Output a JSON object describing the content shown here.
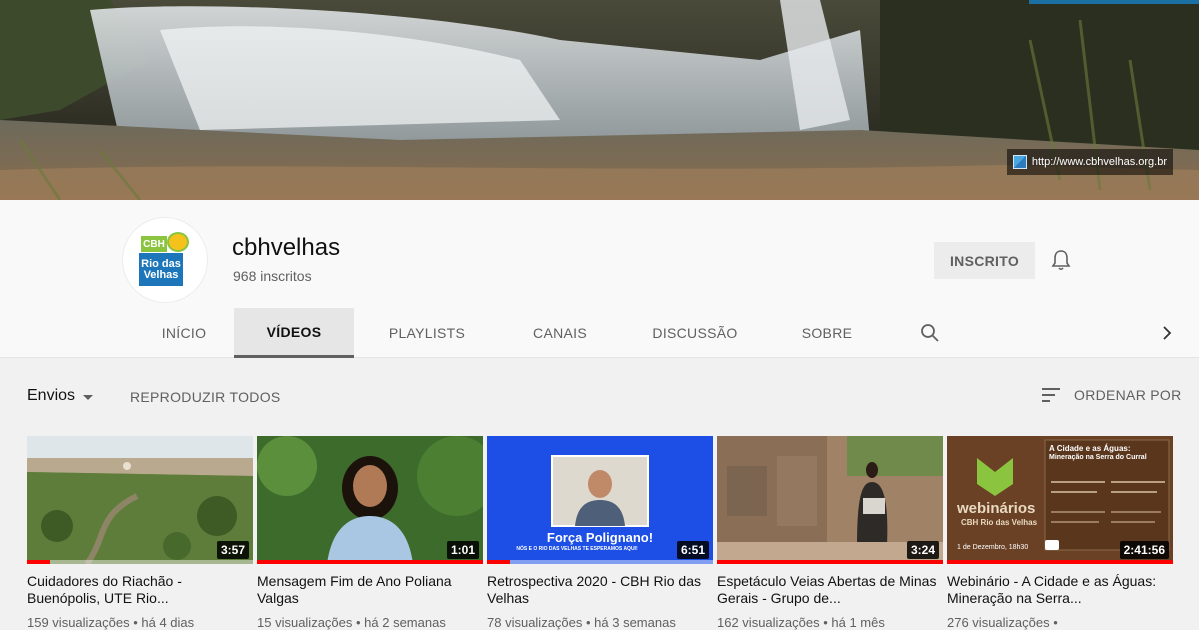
{
  "banner": {
    "link_text": "http://www.cbhvelhas.org.br"
  },
  "channel": {
    "name": "cbhvelhas",
    "subscribers": "968 inscritos",
    "subscribed_label": "INSCRITO",
    "avatar_top": "CBH",
    "avatar_bottom": "Rio das Velhas"
  },
  "tabs": [
    {
      "label": "INÍCIO",
      "active": false
    },
    {
      "label": "VÍDEOS",
      "active": true
    },
    {
      "label": "PLAYLISTS",
      "active": false
    },
    {
      "label": "CANAIS",
      "active": false
    },
    {
      "label": "DISCUSSÃO",
      "active": false
    },
    {
      "label": "SOBRE",
      "active": false
    }
  ],
  "toolbar": {
    "uploads_label": "Envios",
    "play_all_label": "REPRODUZIR TODOS",
    "sort_label": "ORDENAR POR"
  },
  "videos": [
    {
      "title": "Cuidadores do Riachão - Buenópolis, UTE Rio...",
      "meta": "159 visualizações • há 4 dias",
      "duration": "3:57",
      "watched": 0.1
    },
    {
      "title": "Mensagem Fim de Ano Poliana Valgas",
      "meta": "15 visualizações • há 2 semanas",
      "duration": "1:01",
      "watched": 1.0
    },
    {
      "title": "Retrospectiva 2020 - CBH Rio das Velhas",
      "meta": "78 visualizações • há 3 semanas",
      "duration": "6:51",
      "watched": 0.1
    },
    {
      "title": "Espetáculo Veias Abertas de Minas Gerais - Grupo de...",
      "meta": "162 visualizações • há 1 mês",
      "duration": "3:24",
      "watched": 1.0
    },
    {
      "title": "Webinário - A Cidade e as Águas: Mineração na Serra...",
      "meta": "276 visualizações •",
      "duration": "2:41:56",
      "watched": 1.0,
      "thumb_text": {
        "brand": "webinários",
        "sub": "CBH Rio das Velhas",
        "headline": "A Cidade e as Águas:",
        "headline2": "Mineração na Serra do Curral",
        "date": "1 de Dezembro, 18h30"
      }
    }
  ],
  "thumb3_text": {
    "line1": "Força Polignano!",
    "line2": "NÓS E O RIO DAS VELHAS TE ESPERAMOS AQUI!"
  },
  "colors": {
    "accent_red": "#ff0000",
    "tab_underline": "#606060",
    "brand_blue": "#1c76b9",
    "brand_green": "#8bc53f"
  }
}
